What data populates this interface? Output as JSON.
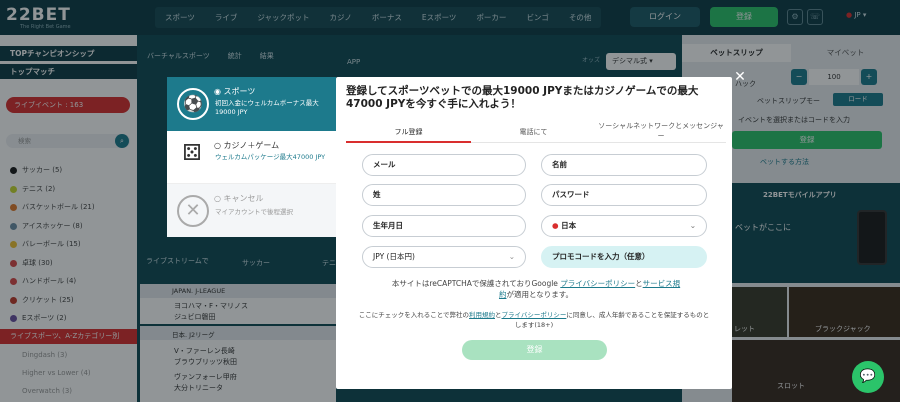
{
  "header": {
    "logo_main": "22BET",
    "logo_sub": "The Right Bet Game",
    "nav": [
      "スポーツ",
      "ライブ",
      "ジャックポット",
      "カジノ",
      "ボーナス",
      "Eスポーツ",
      "ポーカー",
      "ビンゴ",
      "その他"
    ],
    "login_label": "ログイン",
    "register_label": "登録",
    "lang": "JP"
  },
  "sidebar": {
    "top_champ": "TOPチャンピオンシップ",
    "top_match": "トップマッチ",
    "live_events": "ライブイベント : 163",
    "search_placeholder": "検索",
    "sports": [
      {
        "label": "サッカー (5)",
        "color": "#1a1a1a"
      },
      {
        "label": "テニス (2)",
        "color": "#c7d930"
      },
      {
        "label": "バスケットボール (21)",
        "color": "#e07a2c"
      },
      {
        "label": "アイスホッケー (8)",
        "color": "#6c8fa6"
      },
      {
        "label": "バレーボール (15)",
        "color": "#f0c233"
      },
      {
        "label": "卓球 (30)",
        "color": "#d94747"
      },
      {
        "label": "ハンドボール (4)",
        "color": "#d94747"
      },
      {
        "label": "クリケット (25)",
        "color": "#c0392b"
      },
      {
        "label": "Eスポーツ (2)",
        "color": "#6b4fa0"
      }
    ],
    "live_banner": "ライブスポーツ、A-Zカテゴリー別",
    "bottom_items": [
      "Dingdash (3)",
      "Higher vs Lower (4)",
      "Overwatch (3)"
    ]
  },
  "main": {
    "subnav": [
      "バーチャルスポーツ",
      "統計",
      "結果"
    ],
    "app_label": "APP",
    "odds_label": "オッズ",
    "decimal": "デシマル式",
    "live_stream": "ライブストリームで",
    "soccer": "サッカー",
    "tennis": "テニ",
    "league1": "JAPAN. J-LEAGUE",
    "team1a": "ヨコハマ・F・マリノス",
    "team1b": "ジュビロ磐田",
    "league2": "日本. J2リーグ",
    "team2a": "V・ファーレン長崎",
    "team2b": "ブラウブリッツ秋田",
    "team3a": "ヴァンフォーレ甲府",
    "team3b": "大分トリニータ"
  },
  "right": {
    "betslip": "ベットスリップ",
    "mybets": "マイベット",
    "hack": "ハック",
    "amount": "100",
    "bet_slip_mode": "ベットスリップモー",
    "load": "ロード",
    "event_hint": "イベントを選択またはコードを入力",
    "register": "登録",
    "how_to": "ベットする方法",
    "app_title": "22BETモバイルアプリ",
    "app_text": "ベットがここに",
    "slot": "スロット",
    "blackjack": "ブラックジャック",
    "roulette": "レット"
  },
  "bonus": {
    "sports_title": "スポーツ",
    "sports_desc": "初回入金にウェルカムボーナス最大19000 JPY",
    "casino_title": "カジノ＋ゲーム",
    "casino_desc": "ウェルカムパッケージ最大47000 JPY",
    "cancel_title": "キャンセル",
    "cancel_desc": "マイアカウントで後程選択"
  },
  "modal": {
    "title": "登録してスポーツベットでの最大19000 JPYまたはカジノゲームでの最大47000 JPYを今すぐ手に入れよう！",
    "tabs": [
      "フル登録",
      "電話にて",
      "ソーシャルネットワークとメッセンジャー"
    ],
    "email": "メール",
    "name": "名前",
    "surname": "姓",
    "password": "パスワード",
    "birthdate": "生年月日",
    "country": "日本",
    "currency": "JPY (日本円)",
    "promo": "プロモコードを入力（任意）",
    "recaptcha_pre": "本サイトはreCAPTCHAで保護されておりGoogle ",
    "privacy": "プライバシーポリシー",
    "and": "と",
    "terms": "サービス規",
    "terms2": "約",
    "recaptcha_post": "が適用となります。",
    "consent_pre": "ここにチェックを入れることで弊社の",
    "consent_terms": "利用規約",
    "consent_and": "と",
    "consent_privacy": "プライバシーポリシー",
    "consent_post": "に同意し、成人年齢であることを保証するものとします(18+)",
    "submit": "登録"
  }
}
